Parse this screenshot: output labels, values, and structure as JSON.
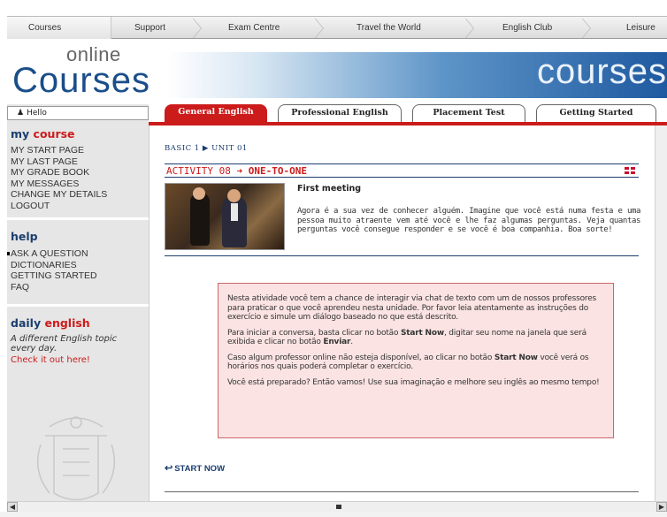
{
  "topnav": {
    "items": [
      "Courses",
      "Support",
      "Exam Centre",
      "Travel the World",
      "English Club",
      "Leisure"
    ]
  },
  "header": {
    "logo_online": "online",
    "logo_courses": "Courses",
    "banner_word": "courses"
  },
  "sidebar": {
    "hello": "Hello",
    "mycourse_title_my": "my",
    "mycourse_title_course": "course",
    "mycourse_items": [
      "MY START PAGE",
      "MY LAST PAGE",
      "MY GRADE BOOK",
      "MY MESSAGES",
      "CHANGE MY DETAILS",
      "LOGOUT"
    ],
    "help_title": "help",
    "help_items": [
      "ASK A QUESTION",
      "DICTIONARIES",
      "GETTING STARTED",
      "FAQ"
    ],
    "daily_title_daily": "daily",
    "daily_title_english": "english",
    "daily_desc": "A different English topic every day.",
    "daily_link": "Check it out here!"
  },
  "tabs": [
    {
      "label": "General English",
      "active": true
    },
    {
      "label": "Professional English",
      "active": false
    },
    {
      "label": "Placement Test",
      "active": false
    },
    {
      "label": "Getting Started",
      "active": false
    }
  ],
  "breadcrumb": {
    "level": "BASIC 1",
    "unit": "UNIT 01"
  },
  "activity": {
    "number": "ACTIVITY 08",
    "title": "ONE-TO-ONE"
  },
  "meeting": {
    "title": "First meeting",
    "text": "Agora é a sua vez de conhecer alguém. Imagine que você está numa festa e uma pessoa muito atraente vem até você e lhe faz algumas perguntas. Veja quantas perguntas você consegue responder e se você é boa companhia. Boa sorte!"
  },
  "instructions": {
    "p1": "Nesta atividade você tem a chance de interagir via chat de texto com um de nossos professores para praticar o que você aprendeu nesta unidade. Por favor leia atentamente as instruções do exercício e simule um diálogo baseado no que está descrito.",
    "p2_a": "Para iniciar a conversa, basta clicar no botão ",
    "p2_b": "Start Now",
    "p2_c": ", digitar seu nome na janela que será exibida e clicar no botão ",
    "p2_d": "Enviar",
    "p2_e": ".",
    "p3_a": "Caso algum professor online não esteja disponível, ao clicar no botão ",
    "p3_b": "Start Now",
    "p3_c": " você verá os horários nos quais poderá completar o exercício.",
    "p4": "Você está preparado? Então vamos! Use sua imaginação e melhore seu inglês ao mesmo tempo!"
  },
  "start_now": "START NOW",
  "colors": {
    "brand_blue": "#1b3d6e",
    "accent_red": "#cc1b1b",
    "box_pink": "#fbe3e3"
  }
}
